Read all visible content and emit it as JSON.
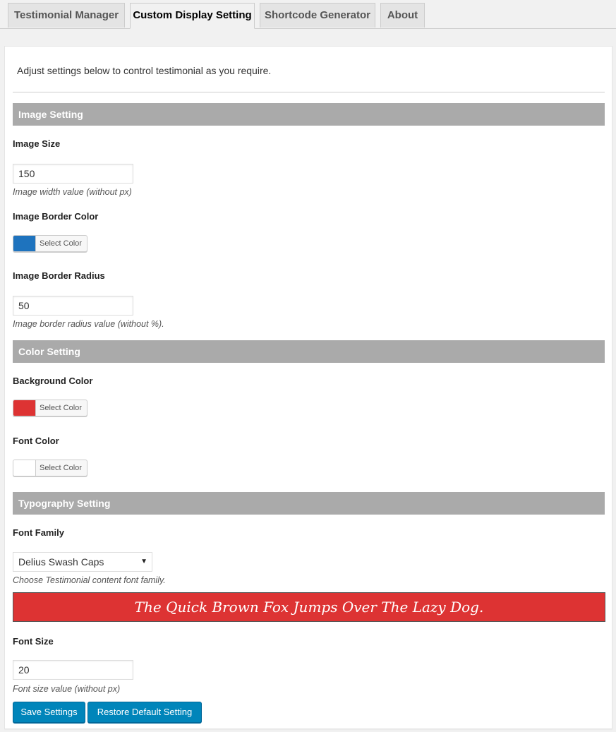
{
  "tabs": [
    {
      "label": "Testimonial Manager",
      "active": false
    },
    {
      "label": "Custom Display Setting",
      "active": true
    },
    {
      "label": "Shortcode Generator",
      "active": false
    },
    {
      "label": "About",
      "active": false
    }
  ],
  "intro": "Adjust settings below to control testimonial as you require.",
  "image_setting": {
    "heading": "Image Setting",
    "size_label": "Image Size",
    "size_value": "150",
    "size_desc": "Image width value (without px)",
    "border_color_label": "Image Border Color",
    "border_color": "#1e73be",
    "border_radius_label": "Image Border Radius",
    "border_radius_value": "50",
    "border_radius_desc": "Image border radius value (without %)."
  },
  "color_setting": {
    "heading": "Color Setting",
    "bg_label": "Background Color",
    "bg_color": "#dd3333",
    "font_label": "Font Color",
    "font_color": "#ffffff"
  },
  "typography": {
    "heading": "Typography Setting",
    "family_label": "Font Family",
    "family_value": "Delius Swash Caps",
    "family_desc": "Choose Testimonial content font family.",
    "preview_text": "The Quick Brown Fox Jumps Over The Lazy Dog.",
    "size_label": "Font Size",
    "size_value": "20",
    "size_desc": "Font size value (without px)"
  },
  "color_picker_label": "Select Color",
  "buttons": {
    "save": "Save Settings",
    "restore": "Restore Default Setting"
  }
}
